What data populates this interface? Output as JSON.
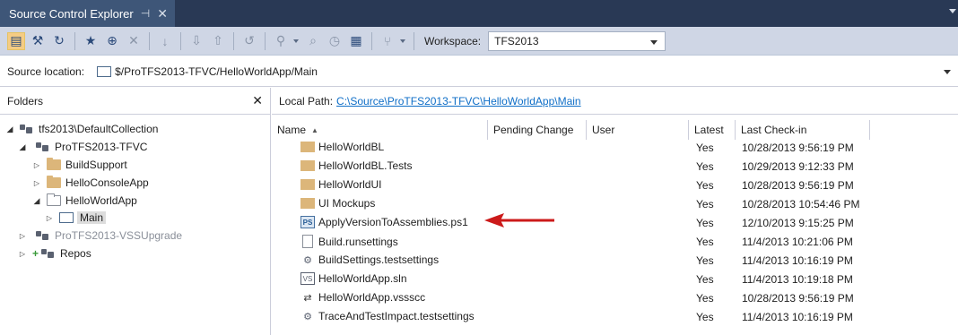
{
  "window": {
    "tab_title": "Source Control Explorer",
    "pin_glyph": "⊣",
    "close_glyph": "✕"
  },
  "toolbar": {
    "workspace_label": "Workspace:",
    "workspace_value": "TFS2013"
  },
  "location": {
    "label": "Source location:",
    "path": "$/ProTFS2013-TFVC/HelloWorldApp/Main"
  },
  "folders": {
    "title": "Folders",
    "close_glyph": "✕",
    "tree": [
      {
        "label": "tfs2013\\DefaultCollection"
      },
      {
        "label": "ProTFS2013-TFVC"
      },
      {
        "label": "BuildSupport"
      },
      {
        "label": "HelloConsoleApp"
      },
      {
        "label": "HelloWorldApp"
      },
      {
        "label": "Main"
      },
      {
        "label": "ProTFS2013-VSSUpgrade"
      },
      {
        "label": "Repos"
      }
    ]
  },
  "local_path": {
    "label": "Local Path:",
    "link": "C:\\Source\\ProTFS2013-TFVC\\HelloWorldApp\\Main"
  },
  "columns": {
    "name": "Name",
    "pending": "Pending Change",
    "user": "User",
    "latest": "Latest",
    "last_checkin": "Last Check-in"
  },
  "files": [
    {
      "name": "HelloWorldBL",
      "icon": "folder-icon",
      "latest": "Yes",
      "last_checkin": "10/28/2013 9:56:19 PM"
    },
    {
      "name": "HelloWorldBL.Tests",
      "icon": "folder-icon",
      "latest": "Yes",
      "last_checkin": "10/29/2013 9:12:33 PM"
    },
    {
      "name": "HelloWorldUI",
      "icon": "folder-icon",
      "latest": "Yes",
      "last_checkin": "10/28/2013 9:56:19 PM"
    },
    {
      "name": "UI Mockups",
      "icon": "folder-icon",
      "latest": "Yes",
      "last_checkin": "10/28/2013 10:54:46 PM"
    },
    {
      "name": "ApplyVersionToAssemblies.ps1",
      "icon": "powershell-file-icon",
      "latest": "Yes",
      "last_checkin": "12/10/2013 9:15:25 PM"
    },
    {
      "name": "Build.runsettings",
      "icon": "document-icon",
      "latest": "Yes",
      "last_checkin": "11/4/2013 10:21:06 PM"
    },
    {
      "name": "BuildSettings.testsettings",
      "icon": "testsettings-icon",
      "latest": "Yes",
      "last_checkin": "11/4/2013 10:16:19 PM"
    },
    {
      "name": "HelloWorldApp.sln",
      "icon": "solution-file-icon",
      "latest": "Yes",
      "last_checkin": "11/4/2013 10:19:18 PM"
    },
    {
      "name": "HelloWorldApp.vssscc",
      "icon": "source-control-binding-icon",
      "latest": "Yes",
      "last_checkin": "10/28/2013 9:56:19 PM"
    },
    {
      "name": "TraceAndTestImpact.testsettings",
      "icon": "testsettings-icon",
      "latest": "Yes",
      "last_checkin": "11/4/2013 10:16:19 PM"
    }
  ],
  "colors": {
    "title_bar": "#293955",
    "toolbar": "#cfd6e5",
    "link": "#0e6ec7",
    "annotation_arrow": "#cc1a1a"
  }
}
